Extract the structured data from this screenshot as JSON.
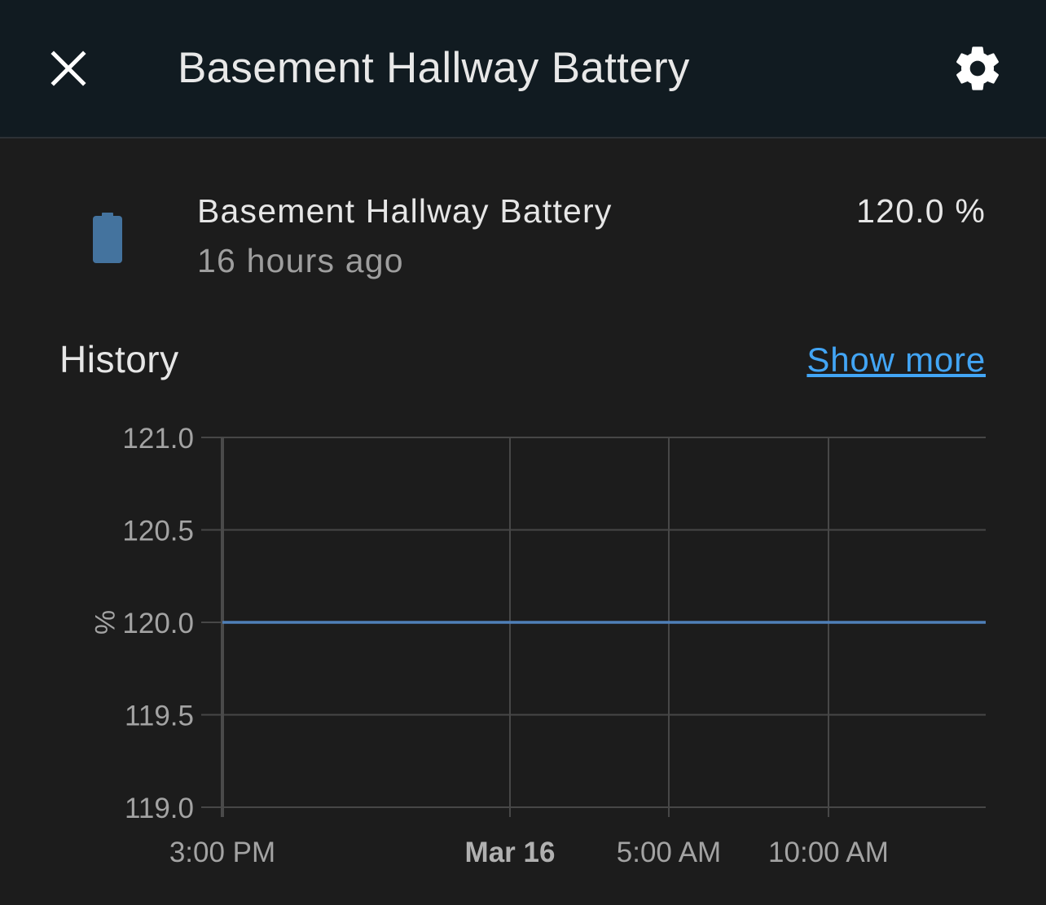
{
  "header": {
    "close_icon": "close-icon",
    "title": "Basement Hallway Battery",
    "settings_icon": "gear-icon"
  },
  "entity": {
    "icon": "battery-icon",
    "icon_color": "#44739e",
    "name": "Basement Hallway Battery",
    "last_changed": "16 hours ago",
    "state": "120.0 %"
  },
  "history": {
    "title": "History",
    "show_more_label": "Show more",
    "link_color": "#42a5f5"
  },
  "chart_data": {
    "type": "line",
    "ylabel": "%",
    "ylim": [
      119.0,
      121.0
    ],
    "y_ticks": [
      "121.0",
      "120.5",
      "120.0",
      "119.5",
      "119.0"
    ],
    "x_tick_labels": [
      {
        "label": "3:00 PM",
        "bold": false
      },
      {
        "label": "Mar 16",
        "bold": true
      },
      {
        "label": "5:00 AM",
        "bold": false
      },
      {
        "label": "10:00 AM",
        "bold": false
      }
    ],
    "series": [
      {
        "color": "#4f7fb8",
        "x": [
          "3:00 PM",
          "end"
        ],
        "values": [
          120.0,
          120.0
        ]
      }
    ],
    "grid": true
  }
}
